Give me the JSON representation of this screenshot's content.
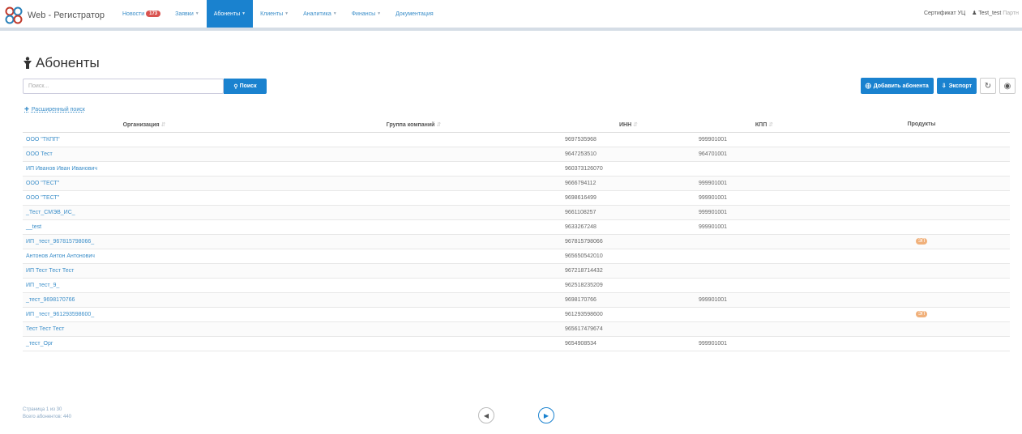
{
  "brand": "Web - Регистратор",
  "nav": [
    {
      "label": "Новости",
      "badge": "173",
      "active": false,
      "caret": false
    },
    {
      "label": "Заявки",
      "active": false,
      "caret": true
    },
    {
      "label": "Абоненты",
      "active": true,
      "caret": true
    },
    {
      "label": "Клиенты",
      "active": false,
      "caret": true
    },
    {
      "label": "Аналитика",
      "active": false,
      "caret": true
    },
    {
      "label": "Финансы",
      "active": false,
      "caret": true
    },
    {
      "label": "Документация",
      "active": false,
      "caret": false
    }
  ],
  "top_right": {
    "certificate": "Сертификат УЦ",
    "user": "Test_test",
    "user_suffix": "Партн"
  },
  "page": {
    "title": "Абоненты"
  },
  "search": {
    "placeholder": "Поиск...",
    "button": "Поиск",
    "advanced": "Расширенный поиск"
  },
  "actions": {
    "add": "Добавить абонента",
    "export": "Экспорт"
  },
  "columns": [
    "Организация",
    "Группа компаний",
    "ИНН",
    "КПП",
    "Продукты"
  ],
  "rows": [
    {
      "org": "ООО \"ТКПП\"",
      "group": "",
      "inn": "9697535968",
      "kpp": "999901001",
      "product": ""
    },
    {
      "org": "ООО Тест",
      "group": "",
      "inn": "9647253510",
      "kpp": "964701001",
      "product": ""
    },
    {
      "org": "ИП Иванов Иван Иванович",
      "group": "",
      "inn": "960373126070",
      "kpp": "",
      "product": ""
    },
    {
      "org": "ООО \"ТЕСТ\"",
      "group": "",
      "inn": "9666794112",
      "kpp": "999901001",
      "product": ""
    },
    {
      "org": "ООО \"ТЕСТ\"",
      "group": "",
      "inn": "9698616499",
      "kpp": "999901001",
      "product": ""
    },
    {
      "org": "_Тест_СМЭВ_ИС_",
      "group": "",
      "inn": "9661108257",
      "kpp": "999901001",
      "product": ""
    },
    {
      "org": "__test",
      "group": "",
      "inn": "9633267248",
      "kpp": "999901001",
      "product": ""
    },
    {
      "org": "ИП _тест_967815798066_",
      "group": "",
      "inn": "967815798066",
      "kpp": "",
      "product": "ЭП"
    },
    {
      "org": "Антонов Антон Антонович",
      "group": "",
      "inn": "965650542010",
      "kpp": "",
      "product": ""
    },
    {
      "org": "ИП Тест Тест Тест",
      "group": "",
      "inn": "967218714432",
      "kpp": "",
      "product": ""
    },
    {
      "org": "ИП _тест_9_",
      "group": "",
      "inn": "962518235209",
      "kpp": "",
      "product": ""
    },
    {
      "org": "_тест_9698170766",
      "group": "",
      "inn": "9698170766",
      "kpp": "999901001",
      "product": ""
    },
    {
      "org": "ИП _тест_961293598600_",
      "group": "",
      "inn": "961293598600",
      "kpp": "",
      "product": "ЭП"
    },
    {
      "org": "Тест Тест Тест",
      "group": "",
      "inn": "965617479674",
      "kpp": "",
      "product": ""
    },
    {
      "org": "_тест_Орг",
      "group": "",
      "inn": "9654908534",
      "kpp": "999901001",
      "product": ""
    }
  ],
  "footer": {
    "page_info": "Страница 1 из 30",
    "total": "Всего абонентов: 440"
  }
}
